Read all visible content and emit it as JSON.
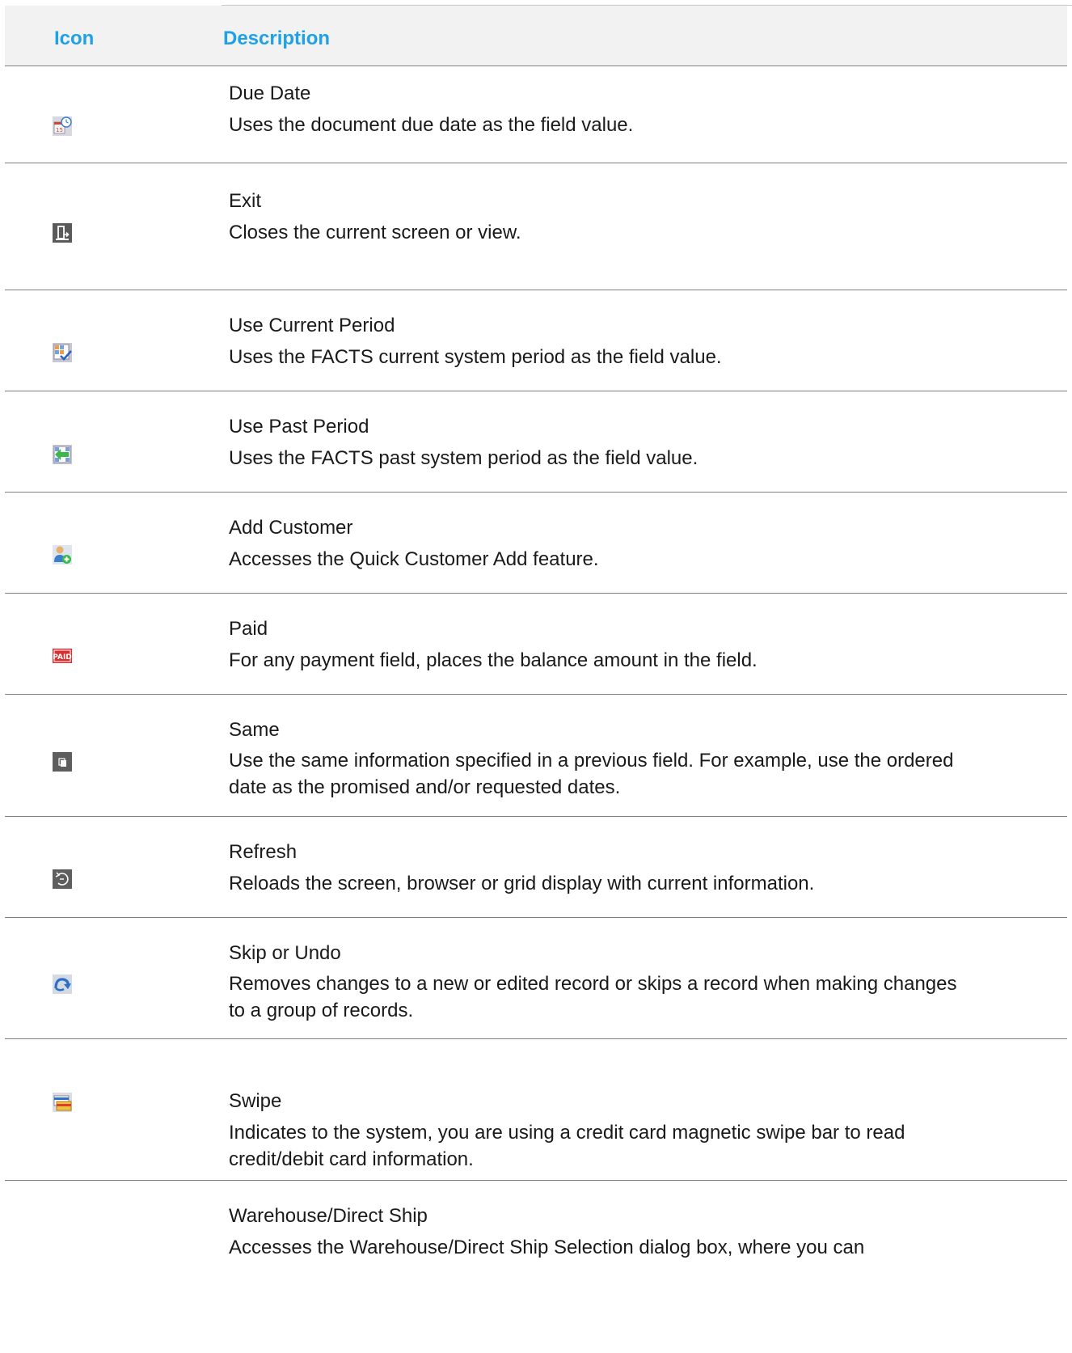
{
  "header": {
    "icon_label": "Icon",
    "description_label": "Description"
  },
  "rows": [
    {
      "icon": "due-date-icon",
      "title": "Due Date",
      "description": "Uses the document due date as the field value."
    },
    {
      "icon": "exit-icon",
      "title": "Exit",
      "description": "Closes the current screen or view."
    },
    {
      "icon": "use-current-period-icon",
      "title": "Use Current Period",
      "description": "Uses the FACTS current system period as the field value."
    },
    {
      "icon": "use-past-period-icon",
      "title": "Use Past Period",
      "description": "Uses the FACTS past system period as the field value."
    },
    {
      "icon": "add-customer-icon",
      "title": "Add Customer",
      "description": "Accesses the Quick Customer Add feature."
    },
    {
      "icon": "paid-icon",
      "title": "Paid",
      "description": "For any payment field, places the balance amount in the field."
    },
    {
      "icon": "same-icon",
      "title": "Same",
      "description": "Use the same information specified in a previous field. For example, use the ordered date as the promised and/or requested dates."
    },
    {
      "icon": "refresh-icon",
      "title": "Refresh",
      "description": "Reloads the screen, browser or grid display with current information."
    },
    {
      "icon": "skip-undo-icon",
      "title": "Skip or Undo",
      "description": "Removes changes to a new or edited record or skips a record when making changes to a group of records."
    },
    {
      "icon": "swipe-icon",
      "title": "Swipe",
      "description": "Indicates to the system, you are using a credit card magnetic swipe bar to read credit/debit card information."
    },
    {
      "icon": "",
      "title": "Warehouse/Direct Ship",
      "description": "Accesses the Warehouse/Direct Ship Selection dialog box, where you can"
    }
  ],
  "colors": {
    "header_text": "#1ea1e6",
    "header_bg": "#f2f2f2",
    "divider": "#808080"
  }
}
